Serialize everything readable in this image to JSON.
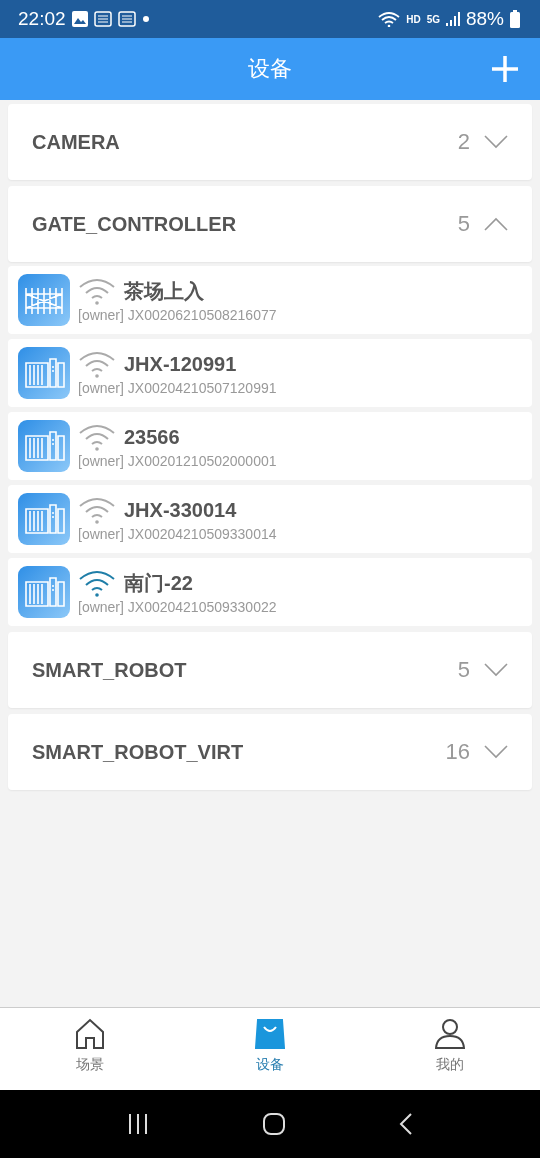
{
  "status_bar": {
    "time": "22:02",
    "network_label": "HD",
    "cell_label": "5G",
    "battery": "88%"
  },
  "header": {
    "title": "设备"
  },
  "groups": [
    {
      "name": "CAMERA",
      "count": "2",
      "expanded": false
    },
    {
      "name": "GATE_CONTROLLER",
      "count": "5",
      "expanded": true,
      "devices": [
        {
          "kind": "fence",
          "name": "茶场上入",
          "owner": "[owner]",
          "serial": "JX00206210508216077",
          "online": false
        },
        {
          "kind": "sliding",
          "name": "JHX-120991",
          "owner": "[owner]",
          "serial": "JX00204210507120991",
          "online": false
        },
        {
          "kind": "sliding",
          "name": "23566",
          "owner": "[owner]",
          "serial": "JX00201210502000001",
          "online": false
        },
        {
          "kind": "sliding",
          "name": "JHX-330014",
          "owner": "[owner]",
          "serial": "JX00204210509330014",
          "online": false
        },
        {
          "kind": "sliding",
          "name": "南门-22",
          "owner": "[owner]",
          "serial": "JX00204210509330022",
          "online": true
        }
      ]
    },
    {
      "name": "SMART_ROBOT",
      "count": "5",
      "expanded": false
    },
    {
      "name": "SMART_ROBOT_VIRT",
      "count": "16",
      "expanded": false
    }
  ],
  "tabs": [
    {
      "kind": "home",
      "label": "场景",
      "selected": false
    },
    {
      "kind": "bag",
      "label": "设备",
      "selected": true
    },
    {
      "kind": "user",
      "label": "我的",
      "selected": false
    }
  ]
}
